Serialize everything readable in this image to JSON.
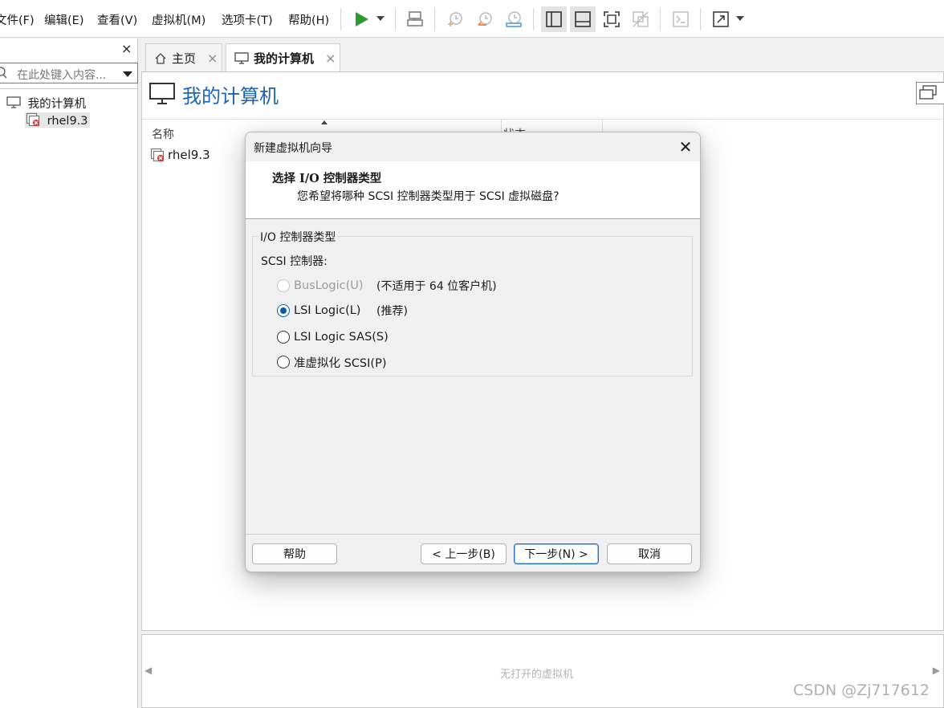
{
  "menubar": {
    "items": [
      "文件(F)",
      "编辑(E)",
      "查看(V)",
      "虚拟机(M)",
      "选项卡(T)",
      "帮助(H)"
    ]
  },
  "toolbar": {
    "icons": [
      "play-icon",
      "send-keys-icon",
      "snapshot-icon",
      "revert-snapshot-icon",
      "snapshot-manager-icon",
      "library-view-icon",
      "thumbnail-view-icon",
      "fullscreen-icon",
      "unity-icon",
      "console-icon",
      "stretch-icon"
    ],
    "accent_play": "#2e9a2e"
  },
  "library": {
    "close_label": "×",
    "search_placeholder": "在此处键入内容...",
    "tree": [
      {
        "label": "我的计算机",
        "icon": "computer-icon"
      },
      {
        "label": "rhel9.3",
        "icon": "vm-error-icon"
      }
    ]
  },
  "tabs": [
    {
      "label": "主页",
      "icon": "home-icon",
      "active": false
    },
    {
      "label": "我的计算机",
      "icon": "monitor-icon",
      "active": true
    }
  ],
  "main": {
    "title": "我的计算机",
    "columns": [
      "名称",
      "状态"
    ],
    "rows": [
      {
        "name": "rhel9.3",
        "icon": "vm-error-icon"
      }
    ]
  },
  "thumbnail_bar": {
    "empty_text": "无打开的虚拟机",
    "left_arrow": "◀",
    "right_arrow": "▶"
  },
  "watermark": "CSDN @Zj717612",
  "dialog": {
    "title": "新建虚拟机向导",
    "step_title": "选择 I/O 控制器类型",
    "step_subtitle": "您希望将哪种 SCSI 控制器类型用于 SCSI 虚拟磁盘?",
    "group_legend": "I/O 控制器类型",
    "scsi_label": "SCSI 控制器:",
    "options": [
      {
        "label": "BusLogic(U)",
        "note": "(不适用于 64 位客户机)",
        "checked": false,
        "disabled": true
      },
      {
        "label": "LSI Logic(L)",
        "note": "(推荐)",
        "checked": true,
        "disabled": false
      },
      {
        "label": "LSI Logic SAS(S)",
        "note": "",
        "checked": false,
        "disabled": false
      },
      {
        "label": "准虚拟化 SCSI(P)",
        "note": "",
        "checked": false,
        "disabled": false
      }
    ],
    "buttons": {
      "help": "帮助",
      "back": "< 上一步(B)",
      "next": "下一步(N) >",
      "cancel": "取消"
    }
  }
}
